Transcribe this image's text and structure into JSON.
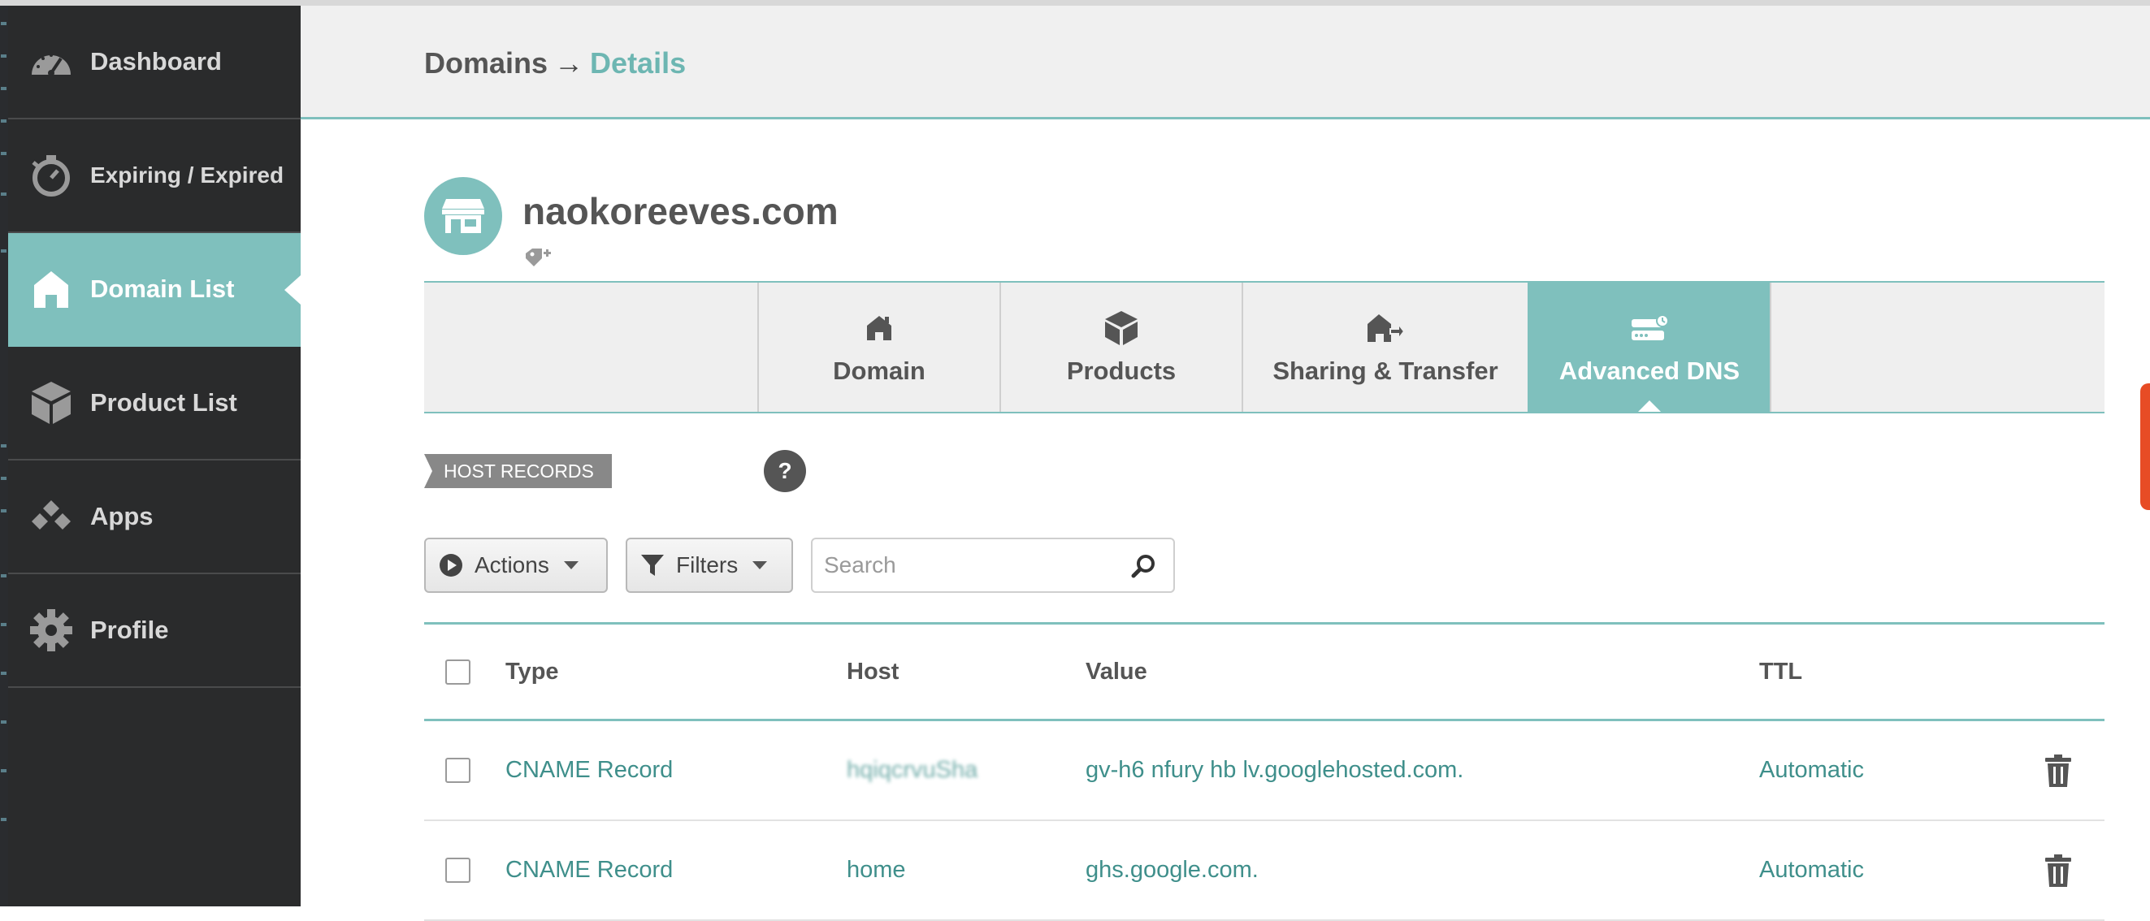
{
  "sidebar": {
    "items": [
      {
        "label": "Dashboard",
        "icon": "dashboard-icon",
        "active": false
      },
      {
        "label": "Expiring / Expired",
        "icon": "stopwatch-icon",
        "active": false
      },
      {
        "label": "Domain List",
        "icon": "home-icon",
        "active": true
      },
      {
        "label": "Product List",
        "icon": "box-icon",
        "active": false
      },
      {
        "label": "Apps",
        "icon": "apps-icon",
        "active": false
      },
      {
        "label": "Profile",
        "icon": "gear-icon",
        "active": false
      }
    ]
  },
  "header": {
    "breadcrumb_root": "Domains",
    "breadcrumb_arrow": "→",
    "breadcrumb_current": "Details"
  },
  "domain": {
    "name": "naokoreeves.com"
  },
  "tabs": [
    {
      "label": "Domain",
      "icon": "house-icon",
      "active": false
    },
    {
      "label": "Products",
      "icon": "package-icon",
      "active": false
    },
    {
      "label": "Sharing & Transfer",
      "icon": "transfer-icon",
      "active": false
    },
    {
      "label": "Advanced DNS",
      "icon": "server-icon",
      "active": true
    }
  ],
  "section": {
    "label": "HOST RECORDS",
    "help": "?"
  },
  "toolbar": {
    "actions_label": "Actions",
    "filters_label": "Filters",
    "search_placeholder": "Search"
  },
  "table": {
    "columns": [
      "Type",
      "Host",
      "Value",
      "TTL"
    ],
    "rows": [
      {
        "type": "CNAME Record",
        "host": "hqiqcrvuSha",
        "value": "gv-h6  nfury hb  lv.googlehosted.com.",
        "ttl": "Automatic"
      },
      {
        "type": "CNAME Record",
        "host": "home",
        "value": "ghs.google.com.",
        "ttl": "Automatic"
      }
    ]
  },
  "colors": {
    "accent": "#7fc0bd",
    "sidebar_bg": "#2a2b2c",
    "link_text": "#3f8f8b"
  }
}
